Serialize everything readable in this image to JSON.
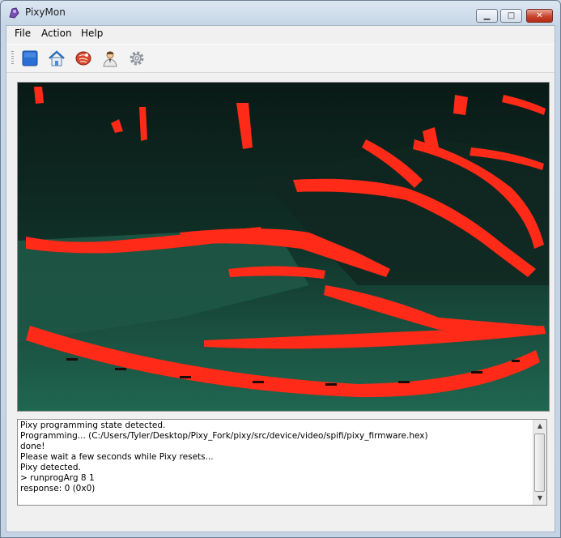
{
  "window": {
    "title": "PixyMon"
  },
  "caption_buttons": {
    "minimize": "▁",
    "maximize": "□",
    "close": "✕"
  },
  "menu": [
    {
      "label": "File"
    },
    {
      "label": "Action"
    },
    {
      "label": "Help"
    }
  ],
  "toolbar": [
    {
      "icon": "stop-icon"
    },
    {
      "icon": "home-icon"
    },
    {
      "icon": "raw-video-icon"
    },
    {
      "icon": "user-icon"
    },
    {
      "icon": "gear-icon"
    }
  ],
  "colors": {
    "overlay": "#ff2a17",
    "scene_dark": "#0d2820",
    "scene_mid": "#1e5a48"
  },
  "log": {
    "lines": [
      "Pixy programming state detected.",
      "Programming... (C:/Users/Tyler/Desktop/Pixy_Fork/pixy/src/device/video/spifi/pixy_firmware.hex)",
      "done!",
      "Please wait a few seconds while Pixy resets...",
      "Pixy detected.",
      "> runprogArg 8 1",
      "response: 0 (0x0)"
    ]
  },
  "scrollbar": {
    "up": "▲",
    "down": "▼"
  }
}
